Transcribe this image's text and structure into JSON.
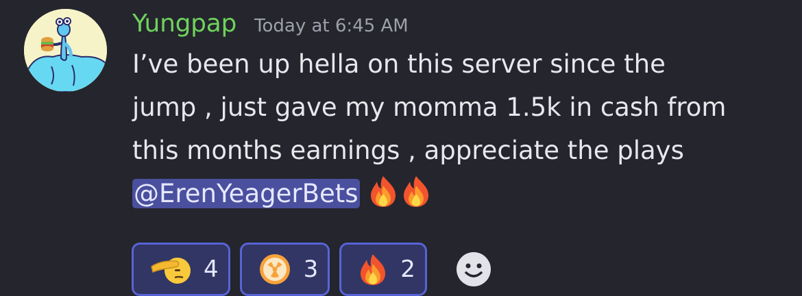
{
  "message": {
    "username": "Yungpap",
    "timestamp": "Today at 6:45 AM",
    "lines": [
      "I’ve been up hella on this server since the",
      "jump , just gave my momma 1.5k in cash from",
      "this months earnings ,  appreciate the plays"
    ],
    "mention": "@ErenYeagerBets",
    "trailing_emoji": [
      "fire-emoji",
      "fire-emoji"
    ]
  },
  "reactions": [
    {
      "emoji": "saluting-face-emoji",
      "count": "4"
    },
    {
      "emoji": "radioactive-emoji",
      "count": "3"
    },
    {
      "emoji": "fire-emoji",
      "count": "2"
    }
  ],
  "add_reaction_icon": "smiley-add-reaction-icon",
  "colors": {
    "background": "#24252d",
    "username": "#6fd25c",
    "timestamp": "#9ea1ab",
    "mention_bg": "#4a4f9e",
    "reaction_border": "#5864d6",
    "reaction_bg": "#323664"
  }
}
